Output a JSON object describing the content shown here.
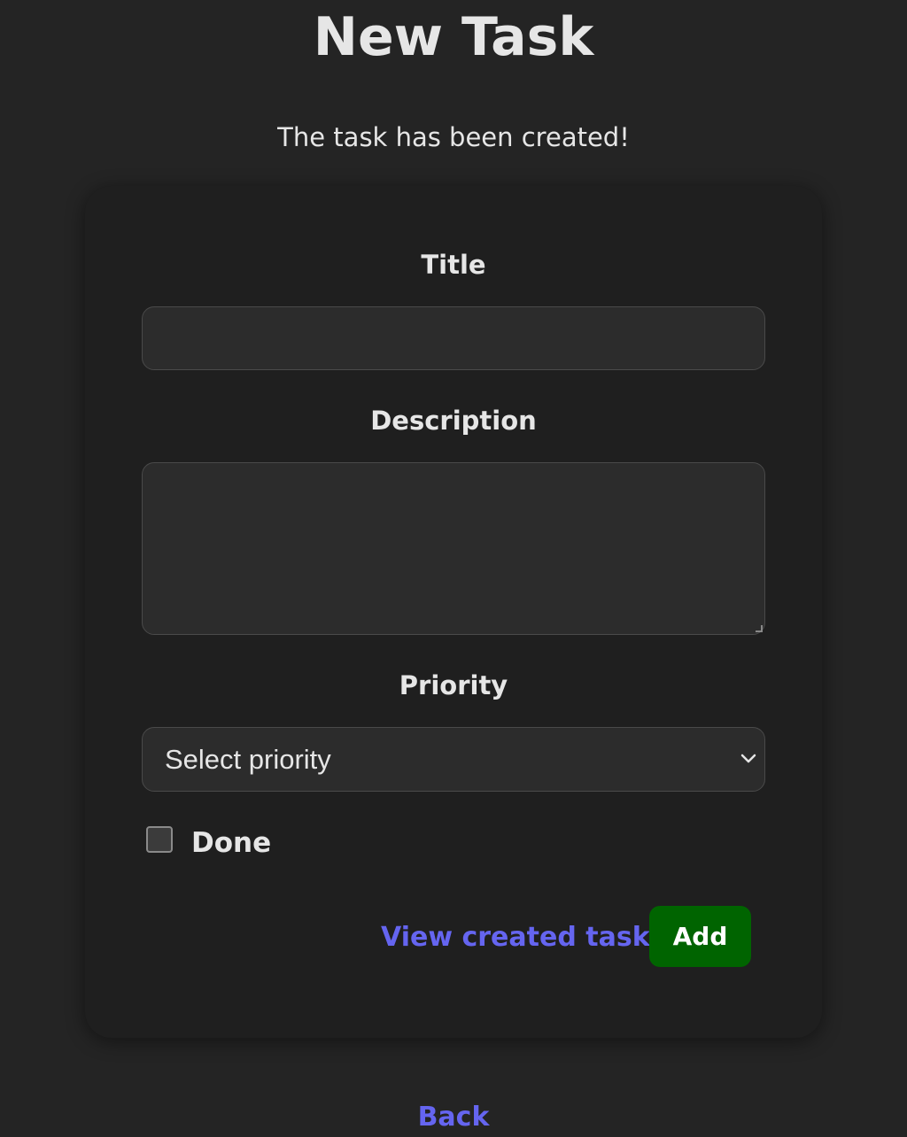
{
  "page": {
    "title": "New Task",
    "status_message": "The task has been created!"
  },
  "form": {
    "title_label": "Title",
    "title_value": "",
    "description_label": "Description",
    "description_value": "",
    "priority_label": "Priority",
    "priority_selected": "Select priority",
    "done_label": "Done",
    "done_checked": false,
    "view_created_link": "View created task",
    "add_button_label": "Add"
  },
  "footer": {
    "back_link": "Back"
  },
  "colors": {
    "background": "#242424",
    "card": "#1f1f1f",
    "link": "#6565f0",
    "add_button": "#006400"
  }
}
